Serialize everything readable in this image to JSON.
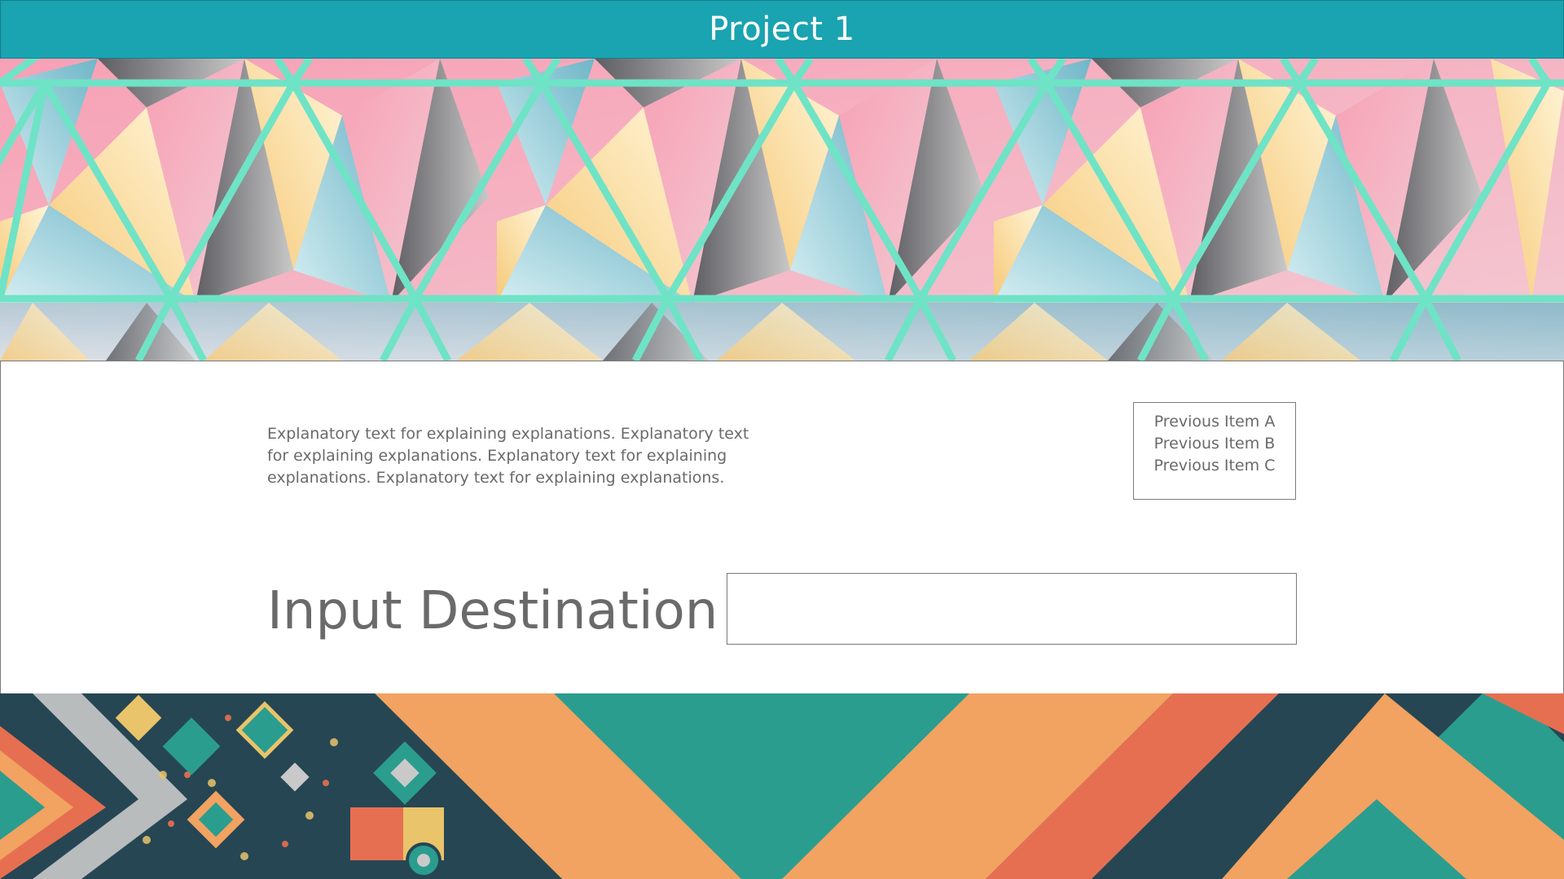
{
  "header": {
    "title": "Project 1"
  },
  "main": {
    "explanation": "Explanatory text for explaining explanations.  Explanatory text for explaining explanations.  Explanatory text for explaining explanations.  Explanatory text for explaining explanations.",
    "previous_items": [
      "Previous Item A",
      "Previous Item B",
      "Previous Item C"
    ],
    "input_label": "Input Destination",
    "destination_input": {
      "value": "",
      "placeholder": ""
    }
  },
  "colors": {
    "header_bg": "#1aa3b0",
    "mint_lines": "#6fe3c6",
    "text_gray": "#6a6a6a",
    "teal": "#2a9d8f",
    "orange": "#f2a261",
    "coral": "#e76f51",
    "navy": "#264653",
    "yellow": "#e9c46a"
  }
}
